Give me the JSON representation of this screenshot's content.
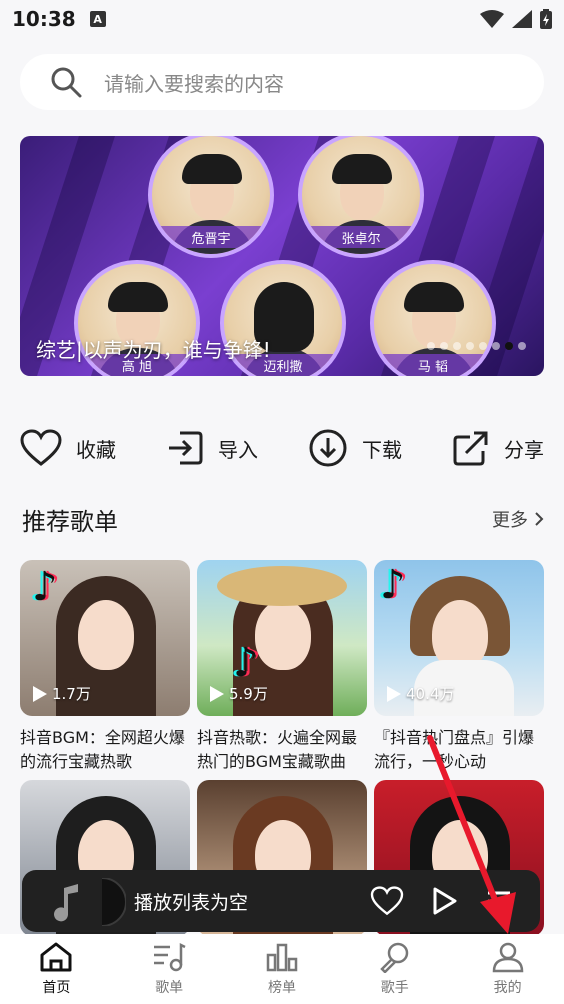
{
  "status_bar": {
    "time": "10:38",
    "notification_badge": "A"
  },
  "search": {
    "placeholder": "请输入要搜索的内容"
  },
  "banner": {
    "caption": "综艺|以声为刃，谁与争锋!",
    "people": [
      "危晋宇",
      "张卓尔",
      "高 旭",
      "迈利撒",
      "马 韬"
    ],
    "dot_count": 8,
    "active_dot": 6
  },
  "actions": [
    {
      "label": "收藏",
      "icon": "heart-icon"
    },
    {
      "label": "导入",
      "icon": "import-icon"
    },
    {
      "label": "下载",
      "icon": "download-icon"
    },
    {
      "label": "分享",
      "icon": "share-icon"
    }
  ],
  "recommended": {
    "title": "推荐歌单",
    "more_label": "更多",
    "cards": [
      {
        "plays": "1.7万",
        "title": "抖音BGM：全网超火爆的流行宝藏热歌"
      },
      {
        "plays": "5.9万",
        "title": "抖音热歌：火遍全网最热门的BGM宝藏歌曲"
      },
      {
        "plays": "40.4万",
        "title": "『抖音热门盘点』引爆流行，一秒心动"
      }
    ]
  },
  "player": {
    "status_text": "播放列表为空"
  },
  "nav": [
    {
      "label": "首页",
      "icon": "home-icon",
      "active": true
    },
    {
      "label": "歌单",
      "icon": "playlist-icon",
      "active": false
    },
    {
      "label": "榜单",
      "icon": "chart-icon",
      "active": false
    },
    {
      "label": "歌手",
      "icon": "microphone-icon",
      "active": false
    },
    {
      "label": "我的",
      "icon": "profile-icon",
      "active": false
    }
  ],
  "colors": {
    "arrow": "#e8192c",
    "player_bg": "#212121",
    "banner": "#7a3fd0"
  }
}
